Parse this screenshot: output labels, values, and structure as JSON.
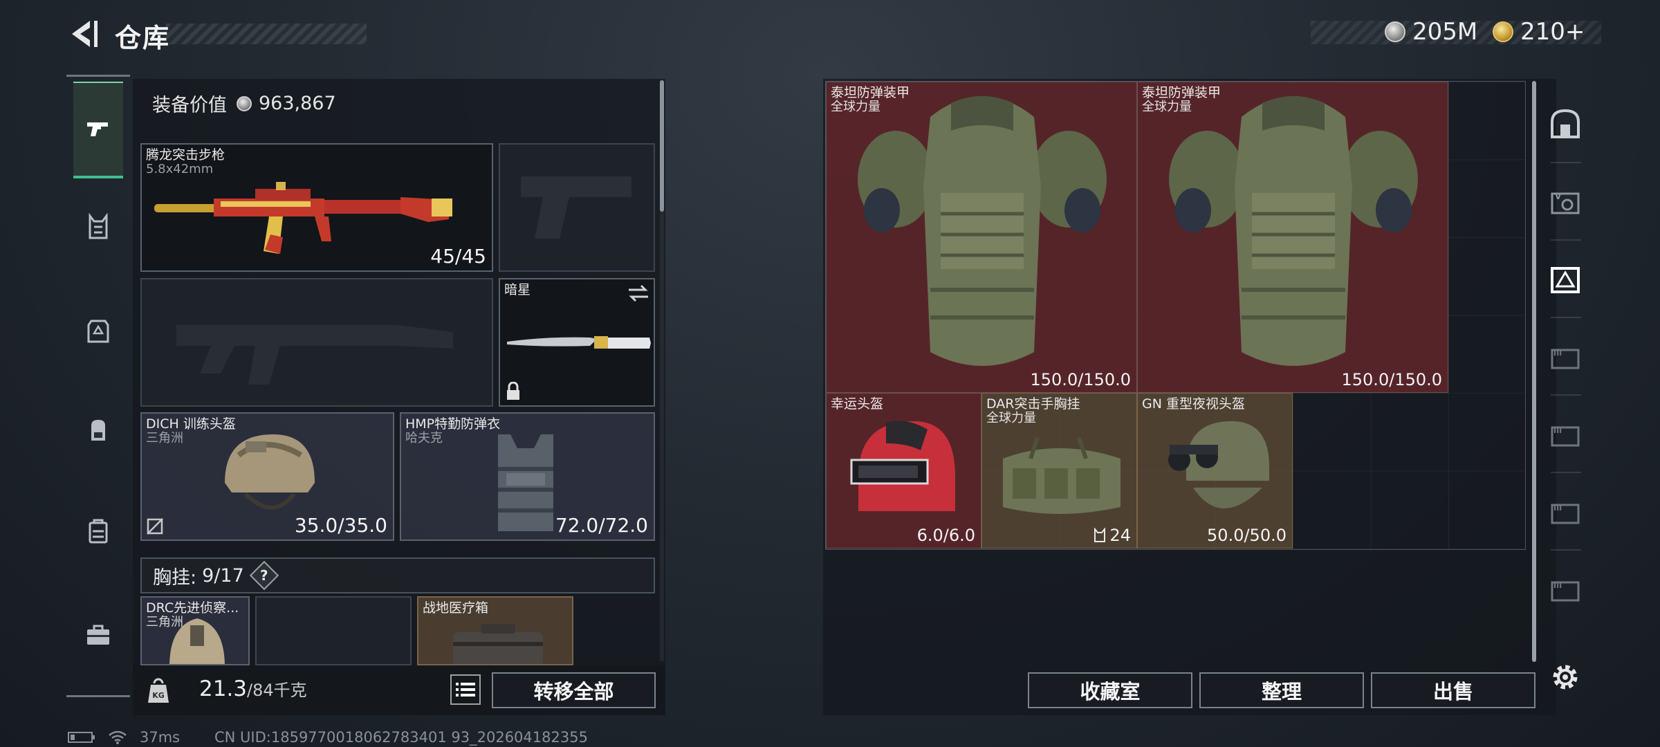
{
  "header": {
    "title": "仓库",
    "currencies": [
      {
        "icon": "silver-coin-icon",
        "amount": "205M"
      },
      {
        "icon": "gold-coin-icon",
        "amount": "210+"
      }
    ]
  },
  "equipment": {
    "value_label": "装备价值",
    "value": "963,867",
    "primary_weapon": {
      "name": "腾龙突击步枪",
      "caliber": "5.8x42mm",
      "ammo": "45/45"
    },
    "melee": {
      "name": "暗星"
    },
    "helmet": {
      "name": "DICH 训练头盔",
      "faction": "三角洲",
      "durability": "35.0/35.0"
    },
    "armor": {
      "name": "HMP特勤防弹衣",
      "faction": "哈夫克",
      "durability": "72.0/72.0"
    },
    "chest_rig": {
      "label": "胸挂:",
      "capacity": "9/17",
      "help": "?"
    },
    "rig_items": [
      {
        "name": "DRC先进侦察...",
        "faction": "三角洲"
      },
      {
        "name": "战地医疗箱"
      }
    ]
  },
  "bottom_left": {
    "weight_current": "21.3",
    "weight_max": "/84千克",
    "transfer_all": "转移全部"
  },
  "stash": {
    "items": [
      {
        "name": "泰坦防弹装甲",
        "sub": "全球力量",
        "value": "150.0/150.0"
      },
      {
        "name": "泰坦防弹装甲",
        "sub": "全球力量",
        "value": "150.0/150.0"
      },
      {
        "name": "幸运头盔",
        "sub": "",
        "value": "6.0/6.0"
      },
      {
        "name": "DAR突击手胸挂",
        "sub": "全球力量",
        "value": "24"
      },
      {
        "name": "GN 重型夜视头盔",
        "sub": "",
        "value": "50.0/50.0"
      }
    ],
    "buttons": {
      "collection": "收藏室",
      "organize": "整理",
      "sell": "出售"
    }
  },
  "status": {
    "ping": "37ms",
    "uid": "CN UID:1859770018062783401 93_202604182355"
  },
  "colors": {
    "accent_green": "#3fbf8f",
    "item_red": "#60262a",
    "item_brown": "#5c4a34"
  }
}
